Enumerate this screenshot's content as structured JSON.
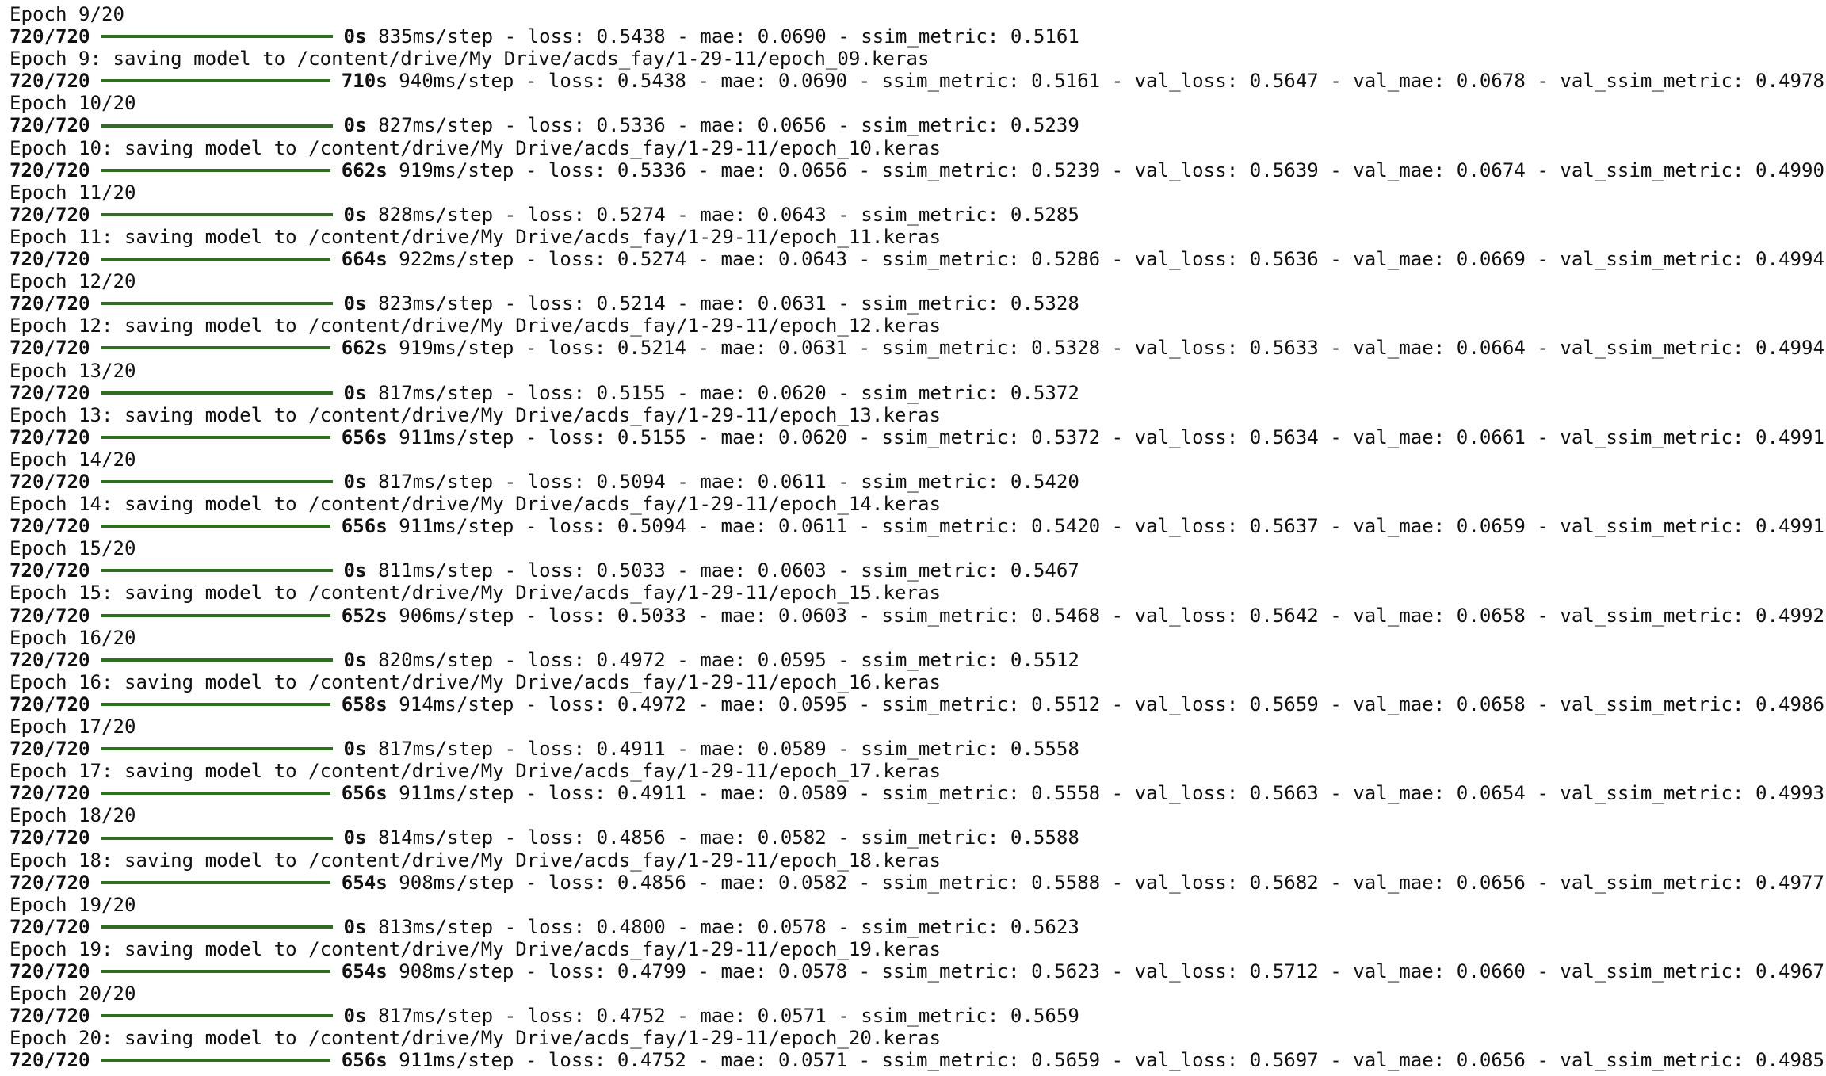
{
  "colors": {
    "background": "#ffffff",
    "text": "#111111",
    "progress_bar": "#2f6e1f"
  },
  "lines": [
    {
      "kind": "text",
      "text": "Epoch 9/20"
    },
    {
      "kind": "progress",
      "counter": "720/720",
      "progress": 1.0,
      "time": "0s",
      "metrics": " 835ms/step - loss: 0.5438 - mae: 0.0690 - ssim_metric: 0.5161"
    },
    {
      "kind": "text",
      "text": "Epoch 9: saving model to /content/drive/My Drive/acds_fay/1-29-11/epoch_09.keras"
    },
    {
      "kind": "progress",
      "counter": "720/720",
      "progress": 1.0,
      "time": "710s",
      "metrics": " 940ms/step - loss: 0.5438 - mae: 0.0690 - ssim_metric: 0.5161 - val_loss: 0.5647 - val_mae: 0.0678 - val_ssim_metric: 0.4978"
    },
    {
      "kind": "text",
      "text": "Epoch 10/20"
    },
    {
      "kind": "progress",
      "counter": "720/720",
      "progress": 1.0,
      "time": "0s",
      "metrics": " 827ms/step - loss: 0.5336 - mae: 0.0656 - ssim_metric: 0.5239"
    },
    {
      "kind": "text",
      "text": "Epoch 10: saving model to /content/drive/My Drive/acds_fay/1-29-11/epoch_10.keras"
    },
    {
      "kind": "progress",
      "counter": "720/720",
      "progress": 1.0,
      "time": "662s",
      "metrics": " 919ms/step - loss: 0.5336 - mae: 0.0656 - ssim_metric: 0.5239 - val_loss: 0.5639 - val_mae: 0.0674 - val_ssim_metric: 0.4990"
    },
    {
      "kind": "text",
      "text": "Epoch 11/20"
    },
    {
      "kind": "progress",
      "counter": "720/720",
      "progress": 1.0,
      "time": "0s",
      "metrics": " 828ms/step - loss: 0.5274 - mae: 0.0643 - ssim_metric: 0.5285"
    },
    {
      "kind": "text",
      "text": "Epoch 11: saving model to /content/drive/My Drive/acds_fay/1-29-11/epoch_11.keras"
    },
    {
      "kind": "progress",
      "counter": "720/720",
      "progress": 1.0,
      "time": "664s",
      "metrics": " 922ms/step - loss: 0.5274 - mae: 0.0643 - ssim_metric: 0.5286 - val_loss: 0.5636 - val_mae: 0.0669 - val_ssim_metric: 0.4994"
    },
    {
      "kind": "text",
      "text": "Epoch 12/20"
    },
    {
      "kind": "progress",
      "counter": "720/720",
      "progress": 1.0,
      "time": "0s",
      "metrics": " 823ms/step - loss: 0.5214 - mae: 0.0631 - ssim_metric: 0.5328"
    },
    {
      "kind": "text",
      "text": "Epoch 12: saving model to /content/drive/My Drive/acds_fay/1-29-11/epoch_12.keras"
    },
    {
      "kind": "progress",
      "counter": "720/720",
      "progress": 1.0,
      "time": "662s",
      "metrics": " 919ms/step - loss: 0.5214 - mae: 0.0631 - ssim_metric: 0.5328 - val_loss: 0.5633 - val_mae: 0.0664 - val_ssim_metric: 0.4994"
    },
    {
      "kind": "text",
      "text": "Epoch 13/20"
    },
    {
      "kind": "progress",
      "counter": "720/720",
      "progress": 1.0,
      "time": "0s",
      "metrics": " 817ms/step - loss: 0.5155 - mae: 0.0620 - ssim_metric: 0.5372"
    },
    {
      "kind": "text",
      "text": "Epoch 13: saving model to /content/drive/My Drive/acds_fay/1-29-11/epoch_13.keras"
    },
    {
      "kind": "progress",
      "counter": "720/720",
      "progress": 1.0,
      "time": "656s",
      "metrics": " 911ms/step - loss: 0.5155 - mae: 0.0620 - ssim_metric: 0.5372 - val_loss: 0.5634 - val_mae: 0.0661 - val_ssim_metric: 0.4991"
    },
    {
      "kind": "text",
      "text": "Epoch 14/20"
    },
    {
      "kind": "progress",
      "counter": "720/720",
      "progress": 1.0,
      "time": "0s",
      "metrics": " 817ms/step - loss: 0.5094 - mae: 0.0611 - ssim_metric: 0.5420"
    },
    {
      "kind": "text",
      "text": "Epoch 14: saving model to /content/drive/My Drive/acds_fay/1-29-11/epoch_14.keras"
    },
    {
      "kind": "progress",
      "counter": "720/720",
      "progress": 1.0,
      "time": "656s",
      "metrics": " 911ms/step - loss: 0.5094 - mae: 0.0611 - ssim_metric: 0.5420 - val_loss: 0.5637 - val_mae: 0.0659 - val_ssim_metric: 0.4991"
    },
    {
      "kind": "text",
      "text": "Epoch 15/20"
    },
    {
      "kind": "progress",
      "counter": "720/720",
      "progress": 1.0,
      "time": "0s",
      "metrics": " 811ms/step - loss: 0.5033 - mae: 0.0603 - ssim_metric: 0.5467"
    },
    {
      "kind": "text",
      "text": "Epoch 15: saving model to /content/drive/My Drive/acds_fay/1-29-11/epoch_15.keras"
    },
    {
      "kind": "progress",
      "counter": "720/720",
      "progress": 1.0,
      "time": "652s",
      "metrics": " 906ms/step - loss: 0.5033 - mae: 0.0603 - ssim_metric: 0.5468 - val_loss: 0.5642 - val_mae: 0.0658 - val_ssim_metric: 0.4992"
    },
    {
      "kind": "text",
      "text": "Epoch 16/20"
    },
    {
      "kind": "progress",
      "counter": "720/720",
      "progress": 1.0,
      "time": "0s",
      "metrics": " 820ms/step - loss: 0.4972 - mae: 0.0595 - ssim_metric: 0.5512"
    },
    {
      "kind": "text",
      "text": "Epoch 16: saving model to /content/drive/My Drive/acds_fay/1-29-11/epoch_16.keras"
    },
    {
      "kind": "progress",
      "counter": "720/720",
      "progress": 1.0,
      "time": "658s",
      "metrics": " 914ms/step - loss: 0.4972 - mae: 0.0595 - ssim_metric: 0.5512 - val_loss: 0.5659 - val_mae: 0.0658 - val_ssim_metric: 0.4986"
    },
    {
      "kind": "text",
      "text": "Epoch 17/20"
    },
    {
      "kind": "progress",
      "counter": "720/720",
      "progress": 1.0,
      "time": "0s",
      "metrics": " 817ms/step - loss: 0.4911 - mae: 0.0589 - ssim_metric: 0.5558"
    },
    {
      "kind": "text",
      "text": "Epoch 17: saving model to /content/drive/My Drive/acds_fay/1-29-11/epoch_17.keras"
    },
    {
      "kind": "progress",
      "counter": "720/720",
      "progress": 1.0,
      "time": "656s",
      "metrics": " 911ms/step - loss: 0.4911 - mae: 0.0589 - ssim_metric: 0.5558 - val_loss: 0.5663 - val_mae: 0.0654 - val_ssim_metric: 0.4993"
    },
    {
      "kind": "text",
      "text": "Epoch 18/20"
    },
    {
      "kind": "progress",
      "counter": "720/720",
      "progress": 1.0,
      "time": "0s",
      "metrics": " 814ms/step - loss: 0.4856 - mae: 0.0582 - ssim_metric: 0.5588"
    },
    {
      "kind": "text",
      "text": "Epoch 18: saving model to /content/drive/My Drive/acds_fay/1-29-11/epoch_18.keras"
    },
    {
      "kind": "progress",
      "counter": "720/720",
      "progress": 1.0,
      "time": "654s",
      "metrics": " 908ms/step - loss: 0.4856 - mae: 0.0582 - ssim_metric: 0.5588 - val_loss: 0.5682 - val_mae: 0.0656 - val_ssim_metric: 0.4977"
    },
    {
      "kind": "text",
      "text": "Epoch 19/20"
    },
    {
      "kind": "progress",
      "counter": "720/720",
      "progress": 1.0,
      "time": "0s",
      "metrics": " 813ms/step - loss: 0.4800 - mae: 0.0578 - ssim_metric: 0.5623"
    },
    {
      "kind": "text",
      "text": "Epoch 19: saving model to /content/drive/My Drive/acds_fay/1-29-11/epoch_19.keras"
    },
    {
      "kind": "progress",
      "counter": "720/720",
      "progress": 1.0,
      "time": "654s",
      "metrics": " 908ms/step - loss: 0.4799 - mae: 0.0578 - ssim_metric: 0.5623 - val_loss: 0.5712 - val_mae: 0.0660 - val_ssim_metric: 0.4967"
    },
    {
      "kind": "text",
      "text": "Epoch 20/20"
    },
    {
      "kind": "progress",
      "counter": "720/720",
      "progress": 1.0,
      "time": "0s",
      "metrics": " 817ms/step - loss: 0.4752 - mae: 0.0571 - ssim_metric: 0.5659"
    },
    {
      "kind": "text",
      "text": "Epoch 20: saving model to /content/drive/My Drive/acds_fay/1-29-11/epoch_20.keras"
    },
    {
      "kind": "progress",
      "counter": "720/720",
      "progress": 1.0,
      "time": "656s",
      "metrics": " 911ms/step - loss: 0.4752 - mae: 0.0571 - ssim_metric: 0.5659 - val_loss: 0.5697 - val_mae: 0.0656 - val_ssim_metric: 0.4985"
    }
  ]
}
